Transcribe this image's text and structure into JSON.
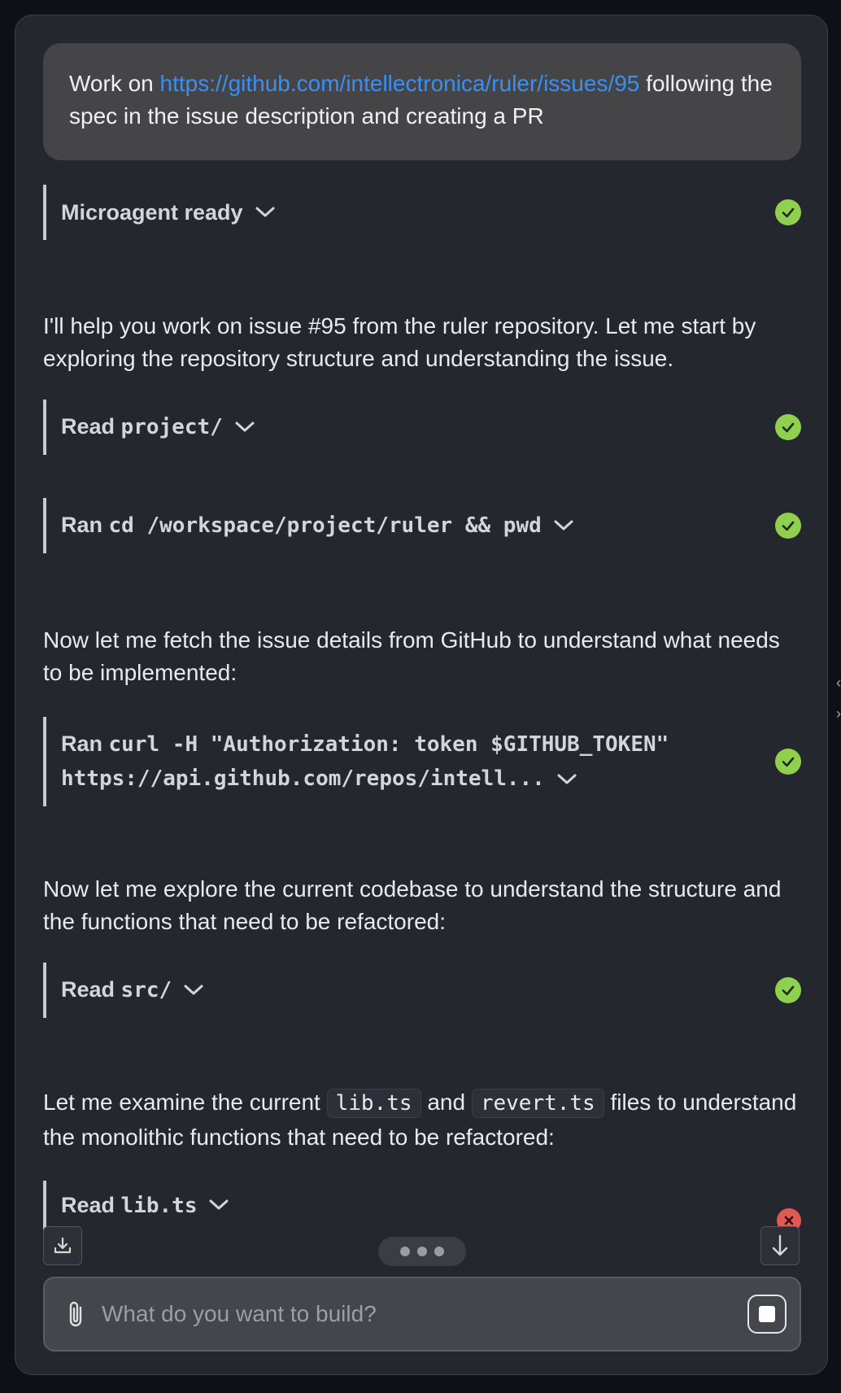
{
  "user_message": {
    "prefix": "Work on ",
    "link": "https://github.com/intellectronica/ruler/issues/95",
    "suffix": " following the spec in the issue description and creating a PR"
  },
  "steps": [
    {
      "verb": "",
      "label": "Microagent ready",
      "status": "success"
    },
    {
      "verb": "Read",
      "label": "project/",
      "status": "success"
    },
    {
      "verb": "Ran",
      "label": "cd /workspace/project/ruler && pwd",
      "status": "success"
    },
    {
      "verb": "Ran",
      "label": "curl -H \"Authorization: token $GITHUB_TOKEN\"",
      "label2": "https://api.github.com/repos/intell...",
      "status": "success"
    },
    {
      "verb": "Read",
      "label": "src/",
      "status": "success"
    },
    {
      "verb": "Read",
      "label": "lib.ts",
      "status": "error"
    }
  ],
  "messages": [
    "I'll help you work on issue #95 from the ruler repository. Let me start by exploring the repository structure and understanding the issue.",
    "Now let me fetch the issue details from GitHub to understand what needs to be implemented:",
    "Now let me explore the current codebase to understand the structure and the functions that need to be refactored:"
  ],
  "message_code": {
    "before": "Let me examine the current ",
    "code1": "lib.ts",
    "middle": " and ",
    "code2": "revert.ts",
    "after": " files to understand the monolithic functions that need to be refactored:"
  },
  "composer": {
    "placeholder": "What do you want to build?"
  },
  "colors": {
    "success": "#8fd14f",
    "error": "#e05a53",
    "link": "#3b8ff2"
  }
}
